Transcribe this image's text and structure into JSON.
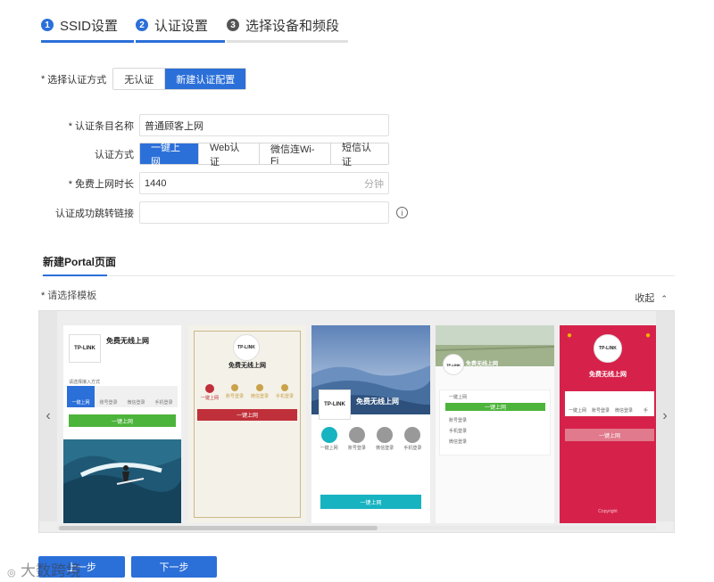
{
  "steps": [
    {
      "num": "1",
      "label": "SSID设置"
    },
    {
      "num": "2",
      "label": "认证设置"
    },
    {
      "num": "3",
      "label": "选择设备和频段"
    }
  ],
  "auth_mode": {
    "label": "选择认证方式",
    "options": [
      "无认证",
      "新建认证配置"
    ],
    "selected": "新建认证配置"
  },
  "form": {
    "name_label": "认证条目名称",
    "name_value": "普通顾客上网",
    "method_label": "认证方式",
    "methods": [
      "一键上网",
      "Web认证",
      "微信连Wi-Fi",
      "短信认证"
    ],
    "method_selected": "一键上网",
    "duration_label": "免费上网时长",
    "duration_value": "1440",
    "duration_unit": "分钟",
    "redirect_label": "认证成功跳转链接",
    "redirect_value": "",
    "info_icon": "info-icon"
  },
  "portal": {
    "section_title": "新建Portal页面",
    "template_label": "请选择模板",
    "collapse_label": "收起",
    "templates": [
      {
        "logo": "TP-LINK",
        "title": "免费无线上网",
        "subtitle": "请选择接入方式",
        "icons": [
          "一键上网",
          "账号登录",
          "微信登录",
          "手机登录"
        ],
        "button": "一键上网"
      },
      {
        "logo": "TP-LINK",
        "title": "免费无线上网",
        "icons": [
          "一键上网",
          "账号登录",
          "微信登录",
          "手机登录"
        ],
        "button": "一键上网"
      },
      {
        "logo": "TP-LINK",
        "title": "免费无线上网",
        "icons": [
          "一键上网",
          "账号登录",
          "微信登录",
          "手机登录"
        ],
        "button": "一键上网"
      },
      {
        "logo": "TP-LINK",
        "title": "免费无线上网",
        "items": [
          "一键上网",
          "账号登录",
          "手机登录",
          "微信登录"
        ],
        "button": "一键上网"
      },
      {
        "logo": "TP-LINK",
        "title": "免费无线上网",
        "icons": [
          "一键上网",
          "账号登录",
          "微信登录",
          "手"
        ],
        "button": "一键上网",
        "footer": "Copyright"
      }
    ]
  },
  "buttons": {
    "prev": "上一步",
    "next": "下一步"
  },
  "watermark": "大数跨境",
  "colors": {
    "primary": "#2b6fd9",
    "green": "#4db43b",
    "red": "#d6224a"
  }
}
